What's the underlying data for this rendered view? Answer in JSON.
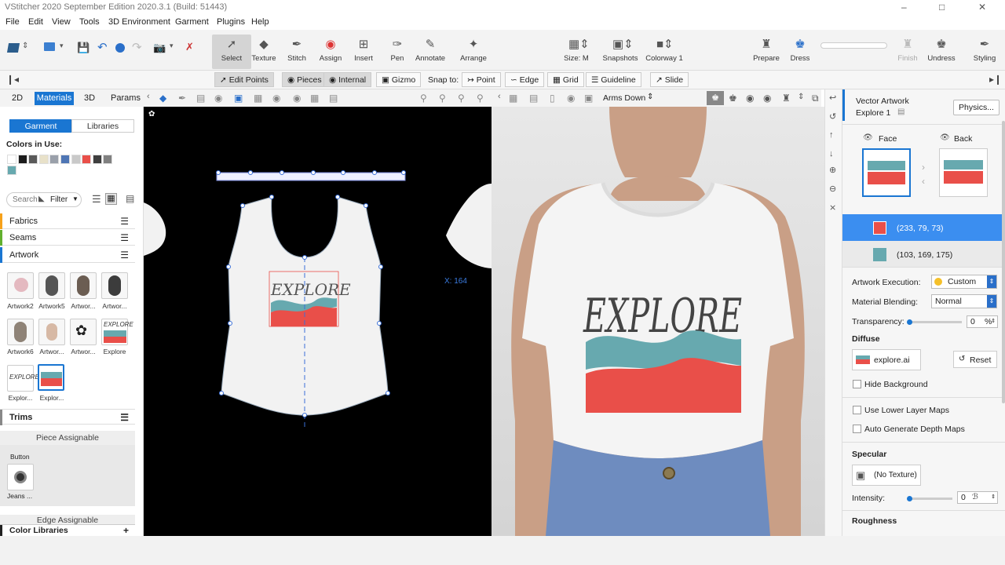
{
  "app": {
    "title": "VStitcher 2020 September Edition 2020.3.1 (Build: 51443)"
  },
  "menu": [
    "File",
    "Edit",
    "View",
    "Tools",
    "3D Environment",
    "Garment",
    "Plugins",
    "Help"
  ],
  "toolbar": {
    "tools": [
      {
        "label": "Select",
        "icon": "cursor-icon"
      },
      {
        "label": "Texture",
        "icon": "texture-icon"
      },
      {
        "label": "Stitch",
        "icon": "stitch-icon"
      },
      {
        "label": "Assign",
        "icon": "assign-icon"
      },
      {
        "label": "Insert",
        "icon": "insert-icon"
      },
      {
        "label": "Pen",
        "icon": "pen-icon"
      },
      {
        "label": "Annotate",
        "icon": "annotate-icon"
      },
      {
        "label": "Arrange",
        "icon": "arrange-icon"
      }
    ],
    "size": "Size: M",
    "snapshots": "Snapshots",
    "colorway": "Colorway 1",
    "right_tools": [
      {
        "label": "Prepare",
        "icon": "prepare-icon"
      },
      {
        "label": "Dress",
        "icon": "dress-icon"
      },
      {
        "label": "Finish",
        "icon": "finish-icon"
      },
      {
        "label": "Undress",
        "icon": "undress-icon"
      },
      {
        "label": "Styling",
        "icon": "styling-icon"
      }
    ]
  },
  "snapbar": {
    "edit_points": "Edit Points",
    "pieces": "Pieces",
    "internal": "Internal",
    "gizmo": "Gizmo",
    "snap_to": "Snap to:",
    "point": "Point",
    "edge": "Edge",
    "grid": "Grid",
    "guideline": "Guideline",
    "slide": "Slide"
  },
  "left_tabs": [
    "2D",
    "Materials",
    "3D",
    "Params"
  ],
  "left": {
    "garment": "Garment",
    "libraries": "Libraries",
    "colors_in_use": "Colors in Use:",
    "colors": [
      "#ffffff",
      "#1c1c1c",
      "#5a5a5a",
      "#e8e1c9",
      "#9aa0aa",
      "#4f76b5",
      "#c9c9c9",
      "#e94f49",
      "#3e3e3e",
      "#808080",
      "#67a9af"
    ],
    "search_placeholder": "Search",
    "filter": "Filter",
    "sections": [
      "Fabrics",
      "Seams",
      "Artwork"
    ],
    "artworks": [
      "Artwork2",
      "Artwork5",
      "Artwor...",
      "Artwor...",
      "Artwork6",
      "Artwor...",
      "Artwor...",
      "Explore",
      "Explor...",
      "Explor..."
    ],
    "trims": "Trims",
    "piece_assignable": "Piece Assignable",
    "button_label": "Button",
    "jeans_label": "Jeans ...",
    "edge_assignable": "Edge Assignable",
    "color_libraries": "Color Libraries"
  },
  "pattern": {
    "x_readout": "X: 164",
    "artwork_text": "EXPLORE"
  },
  "view3d": {
    "pose": "Arms Down"
  },
  "right": {
    "title": "Vector Artwork",
    "name": "Explore 1",
    "physics": "Physics...",
    "face": "Face",
    "back": "Back",
    "colors": [
      {
        "rgb": "(233, 79, 73)",
        "hex": "#e94f49"
      },
      {
        "rgb": "(103, 169, 175)",
        "hex": "#67a9af"
      }
    ],
    "artwork_execution_label": "Artwork Execution:",
    "artwork_execution": "Custom",
    "material_blending_label": "Material Blending:",
    "material_blending": "Normal",
    "transparency_label": "Transparency:",
    "transparency": "0",
    "transparency_unit": "%",
    "diffuse": "Diffuse",
    "diffuse_file": "explore.ai",
    "reset": "Reset",
    "hide_background": "Hide Background",
    "use_lower_layer_maps": "Use Lower Layer Maps",
    "auto_generate_depth_maps": "Auto Generate Depth Maps",
    "specular": "Specular",
    "no_texture": "(No Texture)",
    "intensity_label": "Intensity:",
    "intensity": "0",
    "roughness": "Roughness"
  }
}
